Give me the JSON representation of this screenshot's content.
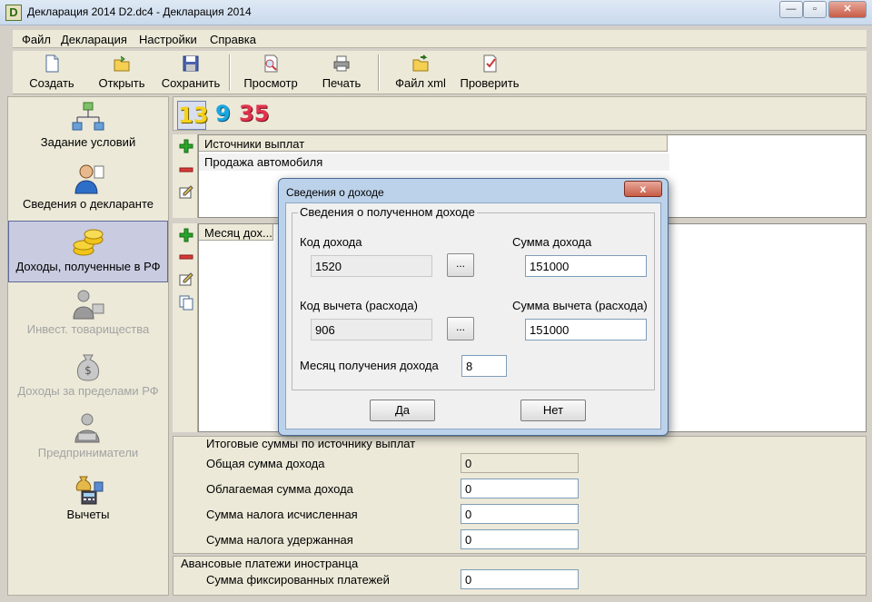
{
  "window": {
    "app_icon_letter": "D",
    "title": "Декларация 2014 D2.dc4 - Декларация 2014",
    "minimize": "—",
    "maximize": "▫",
    "close": "✕"
  },
  "menu": [
    "Файл",
    "Декларация",
    "Настройки",
    "Справка"
  ],
  "toolbar": {
    "create": "Создать",
    "open": "Открыть",
    "save": "Сохранить",
    "preview": "Просмотр",
    "print": "Печать",
    "xml": "Файл xml",
    "check": "Проверить"
  },
  "nav": {
    "items": [
      {
        "label": "Задание условий",
        "icon": "conditions-icon"
      },
      {
        "label": "Сведения о декларанте",
        "icon": "person-icon"
      },
      {
        "label": "Доходы, полученные в РФ",
        "icon": "coins-icon"
      },
      {
        "label": "Инвест. товарищества",
        "icon": "investment-icon"
      },
      {
        "label": "Доходы за пределами РФ",
        "icon": "money-bag-icon"
      },
      {
        "label": "Предприниматели",
        "icon": "entrepreneur-icon"
      },
      {
        "label": "Вычеты",
        "icon": "deductions-icon"
      }
    ]
  },
  "rates": {
    "r13": "13",
    "r9": "9",
    "r35": "35"
  },
  "sources": {
    "header": "Источники выплат",
    "rows": [
      "Продажа автомобиля"
    ]
  },
  "income_grid": {
    "header": "Месяц дох..."
  },
  "totals": {
    "title": "Итоговые суммы по источнику выплат",
    "rows": [
      {
        "label": "Общая сумма дохода",
        "value": "0"
      },
      {
        "label": "Облагаемая сумма дохода",
        "value": "0"
      },
      {
        "label": "Сумма налога исчисленная",
        "value": "0"
      },
      {
        "label": "Сумма налога удержанная",
        "value": "0"
      }
    ]
  },
  "advance": {
    "title": "Авансовые платежи иностранца",
    "label": "Сумма фиксированных платежей",
    "value": "0"
  },
  "dialog": {
    "title": "Сведения о доходе",
    "close": "x",
    "group_title": "Сведения о полученном доходе",
    "income_code_label": "Код дохода",
    "income_code": "1520",
    "income_amount_label": "Сумма дохода",
    "income_amount": "151000",
    "deduction_code_label": "Код вычета (расхода)",
    "deduction_code": "906",
    "deduction_amount_label": "Сумма вычета (расхода)",
    "deduction_amount": "151000",
    "month_label": "Месяц получения дохода",
    "month": "8",
    "dots": "...",
    "yes": "Да",
    "no": "Нет"
  }
}
